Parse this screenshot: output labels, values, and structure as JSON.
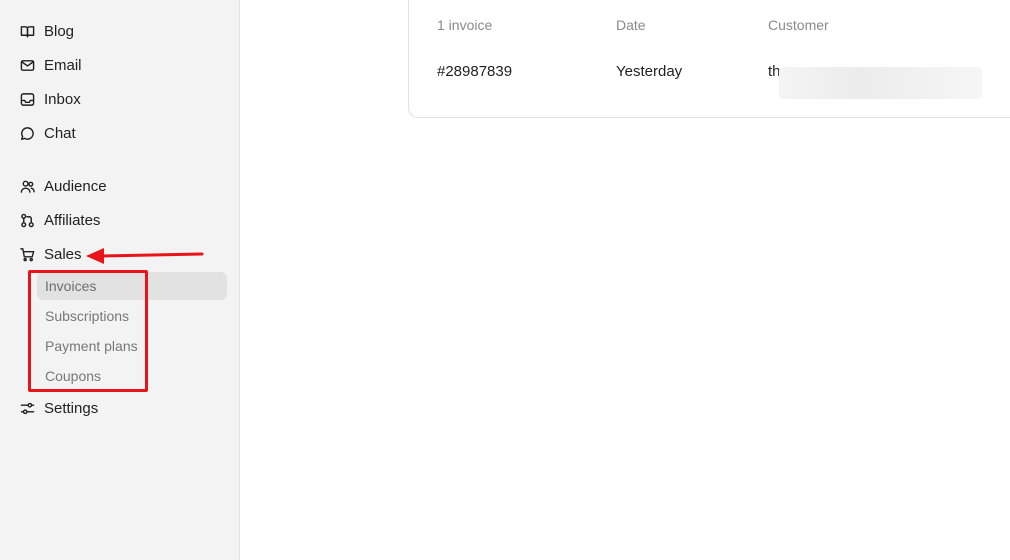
{
  "sidebar": {
    "items": [
      {
        "label": "Blog",
        "icon": "book-icon"
      },
      {
        "label": "Email",
        "icon": "mail-icon"
      },
      {
        "label": "Inbox",
        "icon": "inbox-icon"
      },
      {
        "label": "Chat",
        "icon": "chat-bubble-icon"
      },
      {
        "label": "Audience",
        "icon": "users-icon"
      },
      {
        "label": "Affiliates",
        "icon": "affiliates-icon"
      },
      {
        "label": "Sales",
        "icon": "cart-icon"
      },
      {
        "label": "Settings",
        "icon": "sliders-icon"
      }
    ],
    "sales_subitems": [
      {
        "label": "Invoices",
        "active": true
      },
      {
        "label": "Subscriptions",
        "active": false
      },
      {
        "label": "Payment plans",
        "active": false
      },
      {
        "label": "Coupons",
        "active": false
      }
    ]
  },
  "invoices_table": {
    "headers": [
      "1 invoice",
      "Date",
      "Customer"
    ],
    "rows": [
      {
        "id": "#28987839",
        "date": "Yesterday",
        "customer": "th"
      }
    ]
  },
  "colors": {
    "annotation": "#e8141a",
    "sidebar_bg": "#f3f3f3",
    "active_bg": "#e2e2e2"
  }
}
